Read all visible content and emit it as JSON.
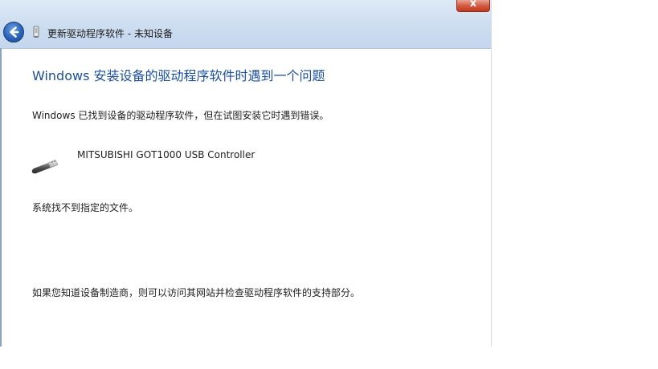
{
  "window": {
    "title": "更新驱动程序软件 - 未知设备",
    "close_glyph": "x"
  },
  "icons": {
    "back": "back-arrow-icon",
    "title_device": "device-icon",
    "usb": "usb-plug-icon",
    "close": "close-icon"
  },
  "content": {
    "heading": "Windows 安装设备的驱动程序软件时遇到一个问题",
    "found_message": "Windows 已找到设备的驱动程序软件，但在试图安装它时遇到错误。",
    "device_name": "MITSUBISHI GOT1000 USB Controller",
    "error_message": "系统找不到指定的文件。",
    "support_hint": "如果您知道设备制造商，则可以访问其网站并检查驱动程序软件的支持部分。"
  },
  "colors": {
    "heading": "#1a4fa0",
    "titlebar": "#cfdff1",
    "close": "#c13a22",
    "back": "#2a63b8"
  }
}
